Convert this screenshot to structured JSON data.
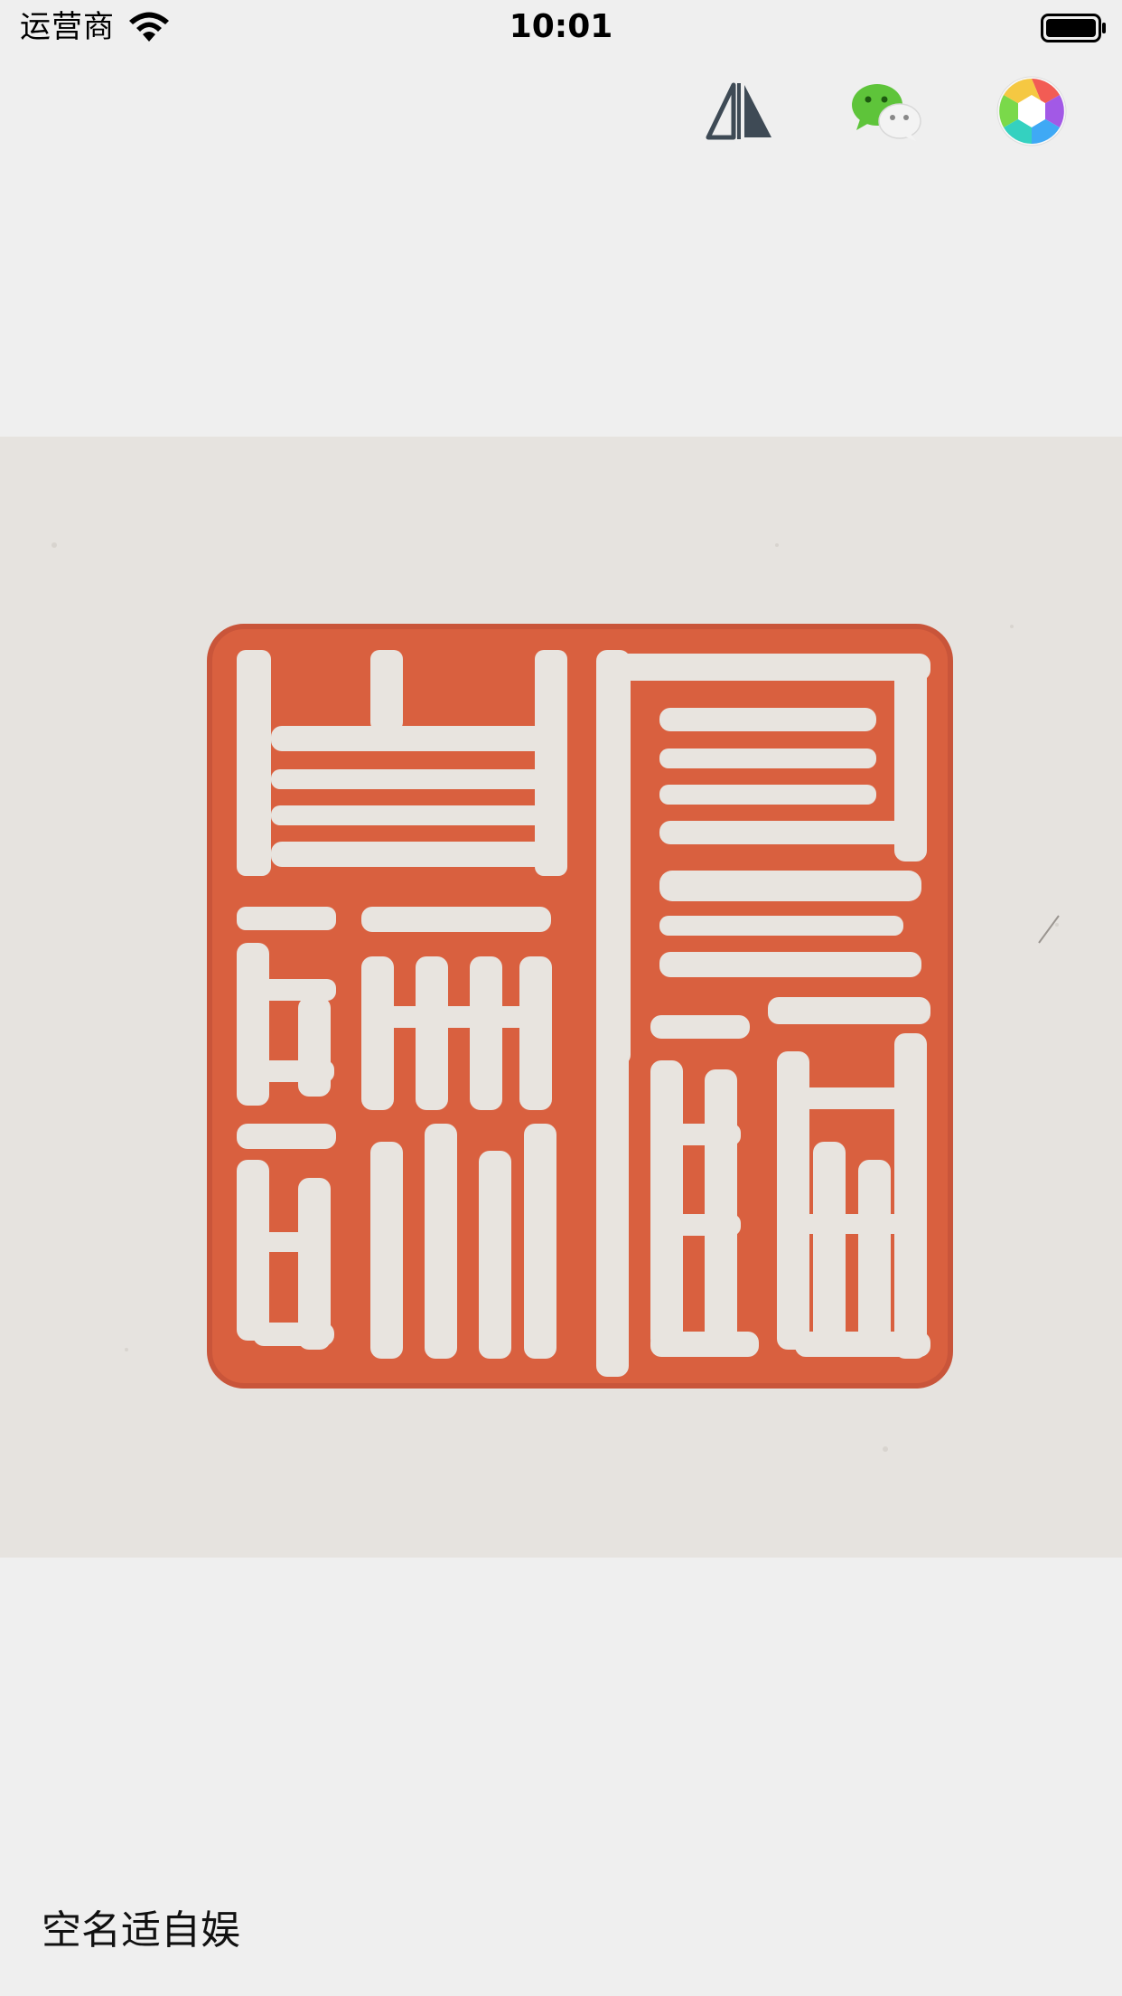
{
  "status_bar": {
    "carrier": "运营商",
    "time": "10:01"
  },
  "toolbar": {
    "buttons": [
      {
        "name": "mirror-flip-icon"
      },
      {
        "name": "wechat-icon"
      },
      {
        "name": "aperture-photos-icon"
      }
    ]
  },
  "seal_image": {
    "seal_color": "#d9603f",
    "paper_color": "#e6e3df"
  },
  "caption": {
    "text": "空名适自娱"
  }
}
